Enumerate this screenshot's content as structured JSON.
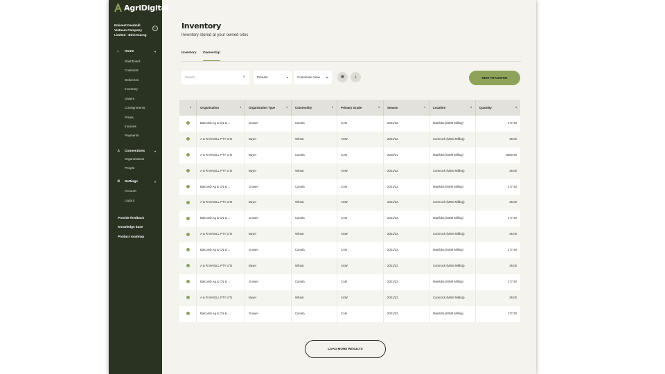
{
  "app": {
    "brand": "AgriDigital"
  },
  "sidebar": {
    "organisation": "Emivest Feedmill Vietnam Company Limited - Binh Duong",
    "sections": [
      {
        "label": "Home",
        "icon": "home-icon",
        "items": [
          "Dashboard",
          "Contracts",
          "Deliveries",
          "Inventory",
          "Orders",
          "Consignments",
          "Prices",
          "Invoices",
          "Payments"
        ]
      },
      {
        "label": "Connections",
        "icon": "people-icon",
        "items": [
          "Organizations",
          "People"
        ]
      },
      {
        "label": "Settings",
        "icon": "gear-icon",
        "items": [
          "Account",
          "Logout"
        ]
      }
    ],
    "extras": [
      "Provide feedback",
      "Knowledge base",
      "Product roadmap"
    ]
  },
  "page": {
    "title": "Inventory",
    "subtitle": "Inventory stored at your owned sites",
    "tabs": [
      "Inventory",
      "Ownership"
    ],
    "active_tab": "Ownership"
  },
  "toolbar": {
    "search_placeholder": "Search...",
    "presets_label": "Presets",
    "customise_label": "Customise View",
    "new_transfer_label": "NEW TRANSFER"
  },
  "table": {
    "columns": [
      "",
      "Organisation",
      "Organisation Type",
      "Commodity",
      "Primary Grade",
      "Season",
      "Location",
      "Quantity"
    ],
    "rows": [
      [
        "Balcomb Ag & CN & ...",
        "Grower",
        "Canola",
        "CAN",
        "2021/22",
        "Manildra (MSM Milling)",
        "177.40"
      ],
      [
        "A & R MAGILL PTY LTD",
        "Buyer",
        "Wheat",
        "ASW",
        "2021/22",
        "Cumnock (MSM Milling)",
        "36.00"
      ],
      [
        "A & R MAGILL PTY LTD",
        "Buyer",
        "Canola",
        "CAN",
        "2020/21",
        "Manildra (MSM Milling)",
        "-3560.90"
      ],
      [
        "A & R MAGILL PTY LTD",
        "Buyer",
        "Wheat",
        "ASW",
        "2021/22",
        "Cumnock (MSM Milling)",
        "36.00"
      ],
      [
        "Balcomb Ag & CN & ...",
        "Grower",
        "Canola",
        "CAN",
        "2021/22",
        "Manildra (MSM Milling)",
        "177.40"
      ],
      [
        "A & R MAGILL PTY LTD",
        "Buyer",
        "Wheat",
        "ASW",
        "2021/22",
        "Cumnock (MSM Milling)",
        "36.00"
      ],
      [
        "Balcomb Ag & CN & ...",
        "Grower",
        "Canola",
        "CAN",
        "2021/22",
        "Manildra (MSM Milling)",
        "177.40"
      ],
      [
        "A & R MAGILL PTY LTD",
        "Buyer",
        "Wheat",
        "ASW",
        "2021/22",
        "Cumnock (MSM Milling)",
        "36.00"
      ],
      [
        "Balcomb Ag & CN & ...",
        "Grower",
        "Canola",
        "CAN",
        "2021/22",
        "Manildra (MSM Milling)",
        "177.40"
      ],
      [
        "A & R MAGILL PTY LTD",
        "Buyer",
        "Wheat",
        "ASW",
        "2021/22",
        "Cumnock (MSM Milling)",
        "36.00"
      ],
      [
        "Balcomb Ag & CN & ...",
        "Grower",
        "Canola",
        "CAN",
        "2021/22",
        "Manildra (MSM Milling)",
        "177.40"
      ],
      [
        "A & R MAGILL PTY LTD",
        "Buyer",
        "Wheat",
        "ASW",
        "2021/22",
        "Cumnock (MSM Milling)",
        "36.00"
      ],
      [
        "Balcomb Ag & CN & ...",
        "Grower",
        "Canola",
        "CAN",
        "2021/22",
        "Manildra (MSM Milling)",
        "177.40"
      ]
    ]
  },
  "footer": {
    "load_more_label": "LOAD MORE RESULTS"
  },
  "colors": {
    "sidebar": "#2a3322",
    "accent": "#8ea35a",
    "page_bg": "#f4f3ee"
  }
}
